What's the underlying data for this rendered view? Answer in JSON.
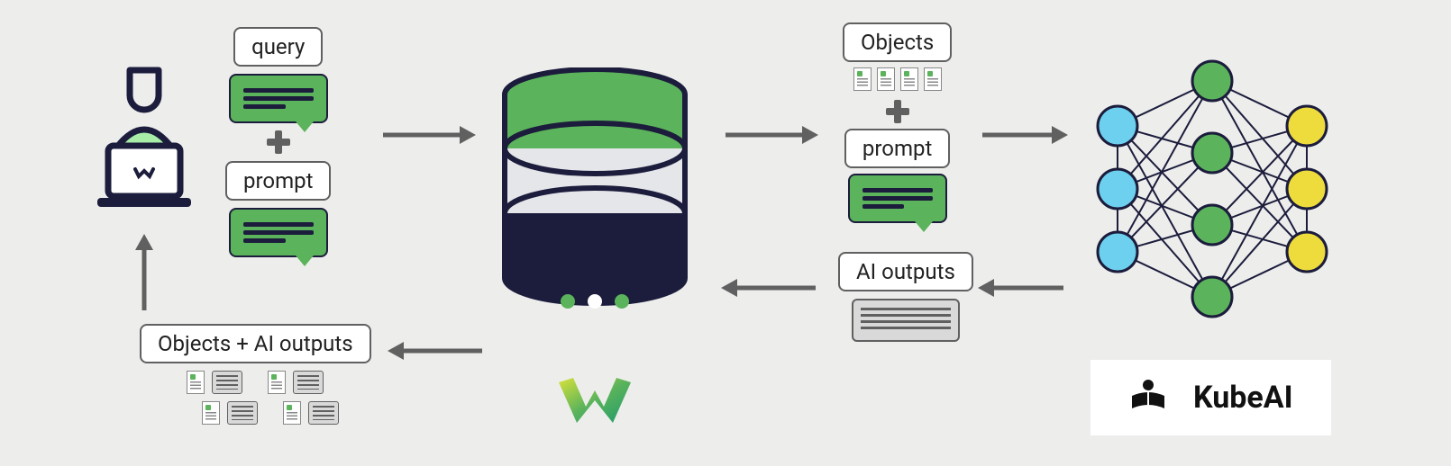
{
  "labels": {
    "query": "query",
    "prompt_left": "prompt",
    "objects": "Objects",
    "prompt_right": "prompt",
    "ai_outputs": "AI outputs",
    "objects_ai_outputs": "Objects + AI outputs"
  },
  "branding": {
    "kubeai": "KubeAI"
  },
  "colors": {
    "green": "#5bb35b",
    "navy": "#1c1c3c",
    "yellow": "#eedb3c",
    "cyan": "#6cd0ee",
    "gray": "#606060",
    "bg": "#edeeec"
  },
  "diagram": {
    "nodes": [
      "user",
      "query+prompt",
      "database",
      "objects+prompt",
      "neural-network",
      "ai-outputs",
      "objects+ai-outputs"
    ],
    "flow_forward": [
      "user→db",
      "db→nn"
    ],
    "flow_back": [
      "nn→db (AI outputs)",
      "db→user (Objects + AI outputs)"
    ]
  }
}
